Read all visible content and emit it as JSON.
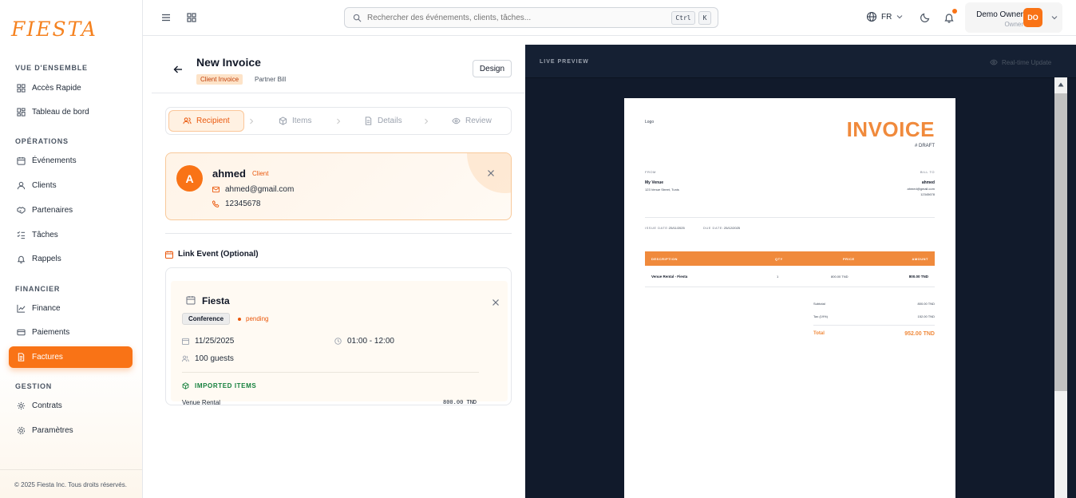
{
  "brand": {
    "logo_text": "FIESTA",
    "accent": "#f97316"
  },
  "sidebar": {
    "sections": [
      {
        "title": "VUE D'ENSEMBLE",
        "items": [
          {
            "label": "Accès Rapide",
            "icon": "grid-icon"
          },
          {
            "label": "Tableau de bord",
            "icon": "dashboard-icon"
          }
        ]
      },
      {
        "title": "OPÉRATIONS",
        "items": [
          {
            "label": "Événements",
            "icon": "calendar-icon"
          },
          {
            "label": "Clients",
            "icon": "user-icon"
          },
          {
            "label": "Partenaires",
            "icon": "handshake-icon"
          },
          {
            "label": "Tâches",
            "icon": "checklist-icon"
          },
          {
            "label": "Rappels",
            "icon": "bell-icon"
          }
        ]
      },
      {
        "title": "FINANCIER",
        "items": [
          {
            "label": "Finance",
            "icon": "chart-line-icon"
          },
          {
            "label": "Paiements",
            "icon": "card-icon"
          },
          {
            "label": "Factures",
            "icon": "invoice-icon",
            "active": true
          }
        ]
      },
      {
        "title": "GESTION",
        "items": [
          {
            "label": "Contrats",
            "icon": "gear-icon"
          },
          {
            "label": "Paramètres",
            "icon": "settings-icon"
          }
        ]
      }
    ],
    "footer": "© 2025 Fiesta Inc. Tous droits réservés."
  },
  "topbar": {
    "search_placeholder": "Rechercher des événements, clients, tâches...",
    "kbd_ctrl": "Ctrl",
    "kbd_k": "K",
    "language": "FR",
    "user_name": "Demo Owner",
    "user_role": "Owner",
    "user_initials": "DO"
  },
  "form": {
    "title": "New Invoice",
    "type_tabs": [
      "Client Invoice",
      "Partner Bill"
    ],
    "design_label": "Design",
    "steps": [
      "Recipient",
      "Items",
      "Details",
      "Review"
    ],
    "recipient": {
      "initial": "A",
      "name": "ahmed",
      "badge": "Client",
      "email": "ahmed@gmail.com",
      "phone": "12345678"
    },
    "link_event_title": "Link Event (Optional)",
    "event": {
      "name": "Fiesta",
      "type": "Conference",
      "status": "pending",
      "date": "11/25/2025",
      "time": "01:00 - 12:00",
      "guests": "100 guests",
      "imported_title": "IMPORTED ITEMS",
      "items": [
        {
          "name": "Venue Rental",
          "amount": "800.00 TND"
        }
      ]
    }
  },
  "preview": {
    "title": "LIVE PREVIEW",
    "realtime_label": "Real-time Update",
    "invoice": {
      "logo": "Logo",
      "title": "INVOICE",
      "number": "# DRAFT",
      "from_label": "FROM",
      "bill_to_label": "BILL TO",
      "from_name": "My Venue",
      "from_address": "123 Venue Street, Tunis",
      "to_name": "ahmed",
      "to_email": "ahmed@gmail.com",
      "to_phone": "12345678",
      "issue_label": "ISSUE DATE:",
      "issue_date": "25/11/2025",
      "due_label": "DUE DATE:",
      "due_date": "25/12/2025",
      "columns": [
        "DESCRIPTION",
        "QTY",
        "PRICE",
        "AMOUNT"
      ],
      "row": {
        "description": "Venue Rental - Fiesta",
        "qty": "1",
        "price": "800.00 TND",
        "amount": "800.00 TND"
      },
      "subtotal_label": "Subtotal",
      "subtotal": "800.00 TND",
      "tax_label": "Tax (19%)",
      "tax": "152.00 TND",
      "total_label": "Total",
      "total": "952.00 TND"
    }
  }
}
